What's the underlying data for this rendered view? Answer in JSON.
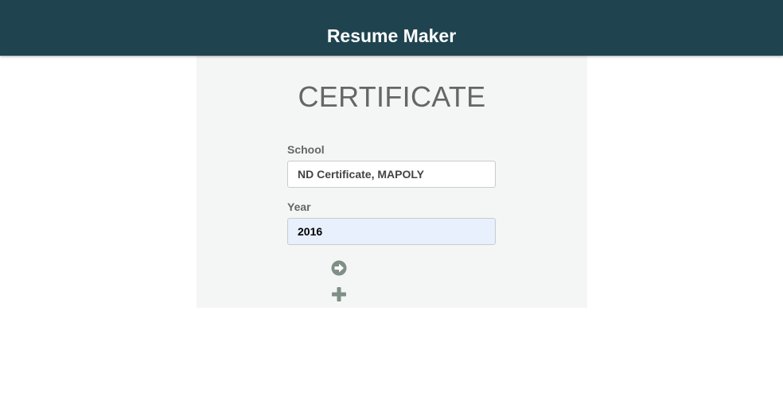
{
  "header": {
    "title": "Resume Maker"
  },
  "section": {
    "title": "CERTIFICATE"
  },
  "form": {
    "school": {
      "label": "School",
      "value": "ND Certificate, MAPOLY"
    },
    "year": {
      "label": "Year",
      "value": "2016"
    }
  },
  "actions": {
    "next_icon": "arrow-right-circle-icon",
    "add_icon": "plus-icon"
  },
  "colors": {
    "header_bg": "#1f4450",
    "panel_bg": "#f4f6f5",
    "icon": "#7f8f86",
    "autofill_bg": "#e8f0fe"
  }
}
